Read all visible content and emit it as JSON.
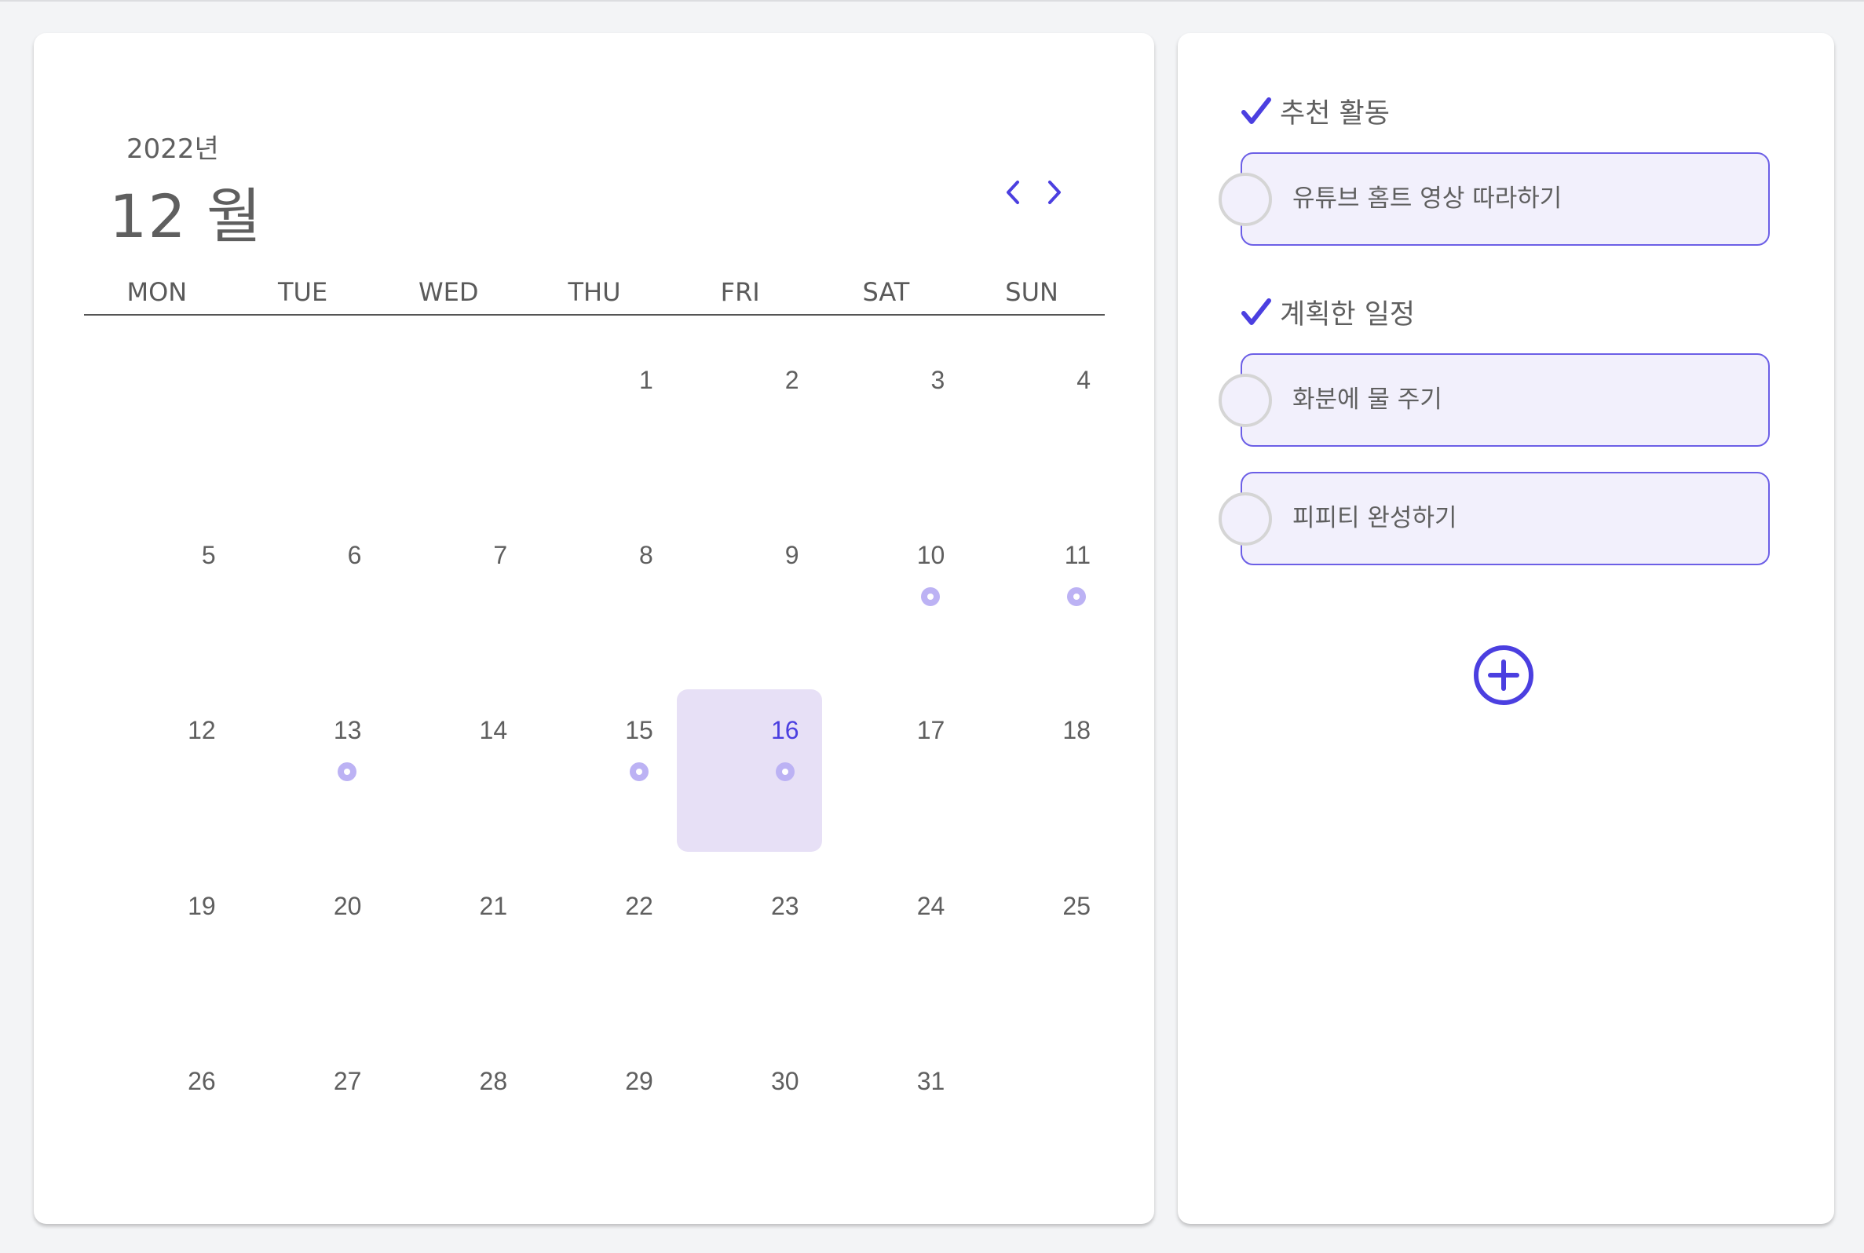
{
  "colors": {
    "accent": "#4b3fe0",
    "selected_day_bg": "#e7e0f6",
    "event_dot": "#bcb2f4",
    "task_bg": "#f2f0fc",
    "task_border": "#6c5fe6",
    "page_bg": "#f3f4f6"
  },
  "calendar": {
    "year_label": "2022년",
    "month_label": "12 월",
    "prev_icon": "chevron-left-icon",
    "next_icon": "chevron-right-icon",
    "weekdays": [
      "MON",
      "TUE",
      "WED",
      "THU",
      "FRI",
      "SAT",
      "SUN"
    ],
    "selected_day": 16,
    "event_days": [
      10,
      11,
      13,
      15,
      16
    ],
    "weeks": [
      [
        "",
        "",
        "",
        "1",
        "2",
        "3",
        "4"
      ],
      [
        "5",
        "6",
        "7",
        "8",
        "9",
        "10",
        "11"
      ],
      [
        "12",
        "13",
        "14",
        "15",
        "16",
        "17",
        "18"
      ],
      [
        "19",
        "20",
        "21",
        "22",
        "23",
        "24",
        "25"
      ],
      [
        "26",
        "27",
        "28",
        "29",
        "30",
        "31",
        ""
      ]
    ]
  },
  "sidebar": {
    "recommended": {
      "title": "추천 활동",
      "icon": "checkmark-icon",
      "tasks": [
        {
          "label": "유튜브 홈트 영상 따라하기",
          "done": false
        }
      ]
    },
    "planned": {
      "title": "계획한 일정",
      "icon": "checkmark-icon",
      "tasks": [
        {
          "label": "화분에 물 주기",
          "done": false
        },
        {
          "label": "피피티 완성하기",
          "done": false
        }
      ]
    },
    "add_icon": "plus-circle-icon"
  }
}
